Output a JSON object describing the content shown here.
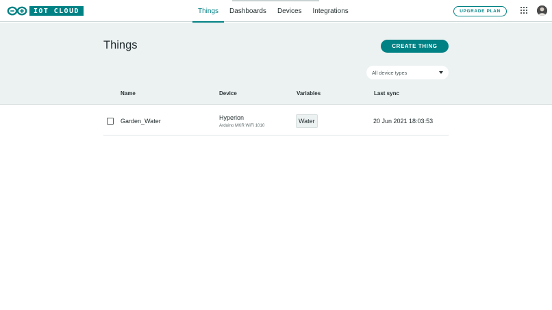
{
  "brand": {
    "logo_text": "IOT CLOUD"
  },
  "nav": {
    "tabs": [
      {
        "label": "Things",
        "active": true
      },
      {
        "label": "Dashboards",
        "active": false
      },
      {
        "label": "Devices",
        "active": false
      },
      {
        "label": "Integrations",
        "active": false
      }
    ]
  },
  "header_actions": {
    "upgrade_label": "UPGRADE PLAN",
    "apps_icon": "grid-9-dots-icon",
    "avatar_icon": "user-avatar"
  },
  "page": {
    "title": "Things",
    "create_label": "CREATE THING",
    "device_filter": {
      "selected": "All device types"
    }
  },
  "table": {
    "columns": [
      "Name",
      "Device",
      "Variables",
      "Last sync"
    ],
    "rows": [
      {
        "selected": false,
        "name": "Garden_Water",
        "device": "Hyperion",
        "device_type": "Arduino MKR WiFi 1010",
        "variables": [
          "Water"
        ],
        "last_sync": "20 Jun 2021 18:03:53"
      }
    ]
  },
  "colors": {
    "accent": "#008184",
    "band": "#ecf1f1",
    "text": "#1f2a2c"
  }
}
